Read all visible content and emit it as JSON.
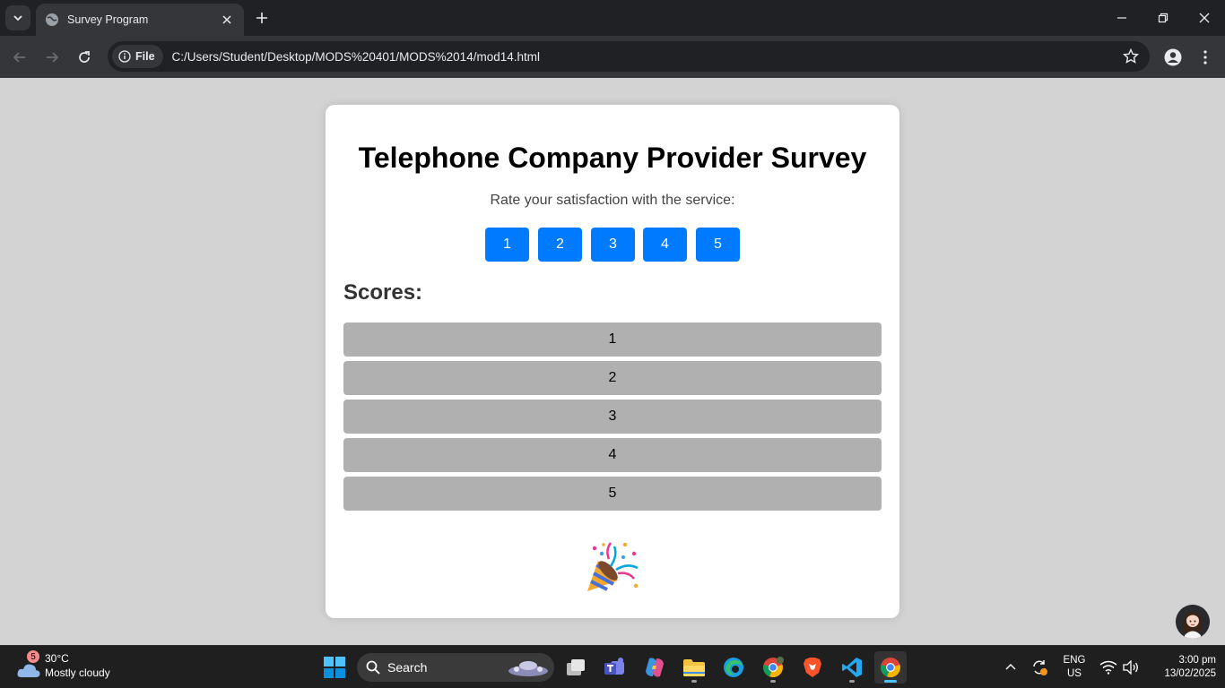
{
  "browser": {
    "tab_title": "Survey Program",
    "site_chip": "File",
    "url": "C:/Users/Student/Desktop/MODS%20401/MODS%2014/mod14.html"
  },
  "page": {
    "title": "Telephone Company Provider Survey",
    "prompt": "Rate your satisfaction with the service:",
    "rating_buttons": [
      "1",
      "2",
      "3",
      "4",
      "5"
    ],
    "scores_heading": "Scores:",
    "scores": [
      "1",
      "2",
      "3",
      "4",
      "5"
    ],
    "celebration_icon": "party-popper-icon"
  },
  "colors": {
    "accent": "#007bff",
    "score_row": "#b0b0b0",
    "page_bg": "#d3d3d3"
  },
  "taskbar": {
    "weather": {
      "badge": "5",
      "temp": "30°C",
      "desc": "Mostly cloudy"
    },
    "search_label": "Search",
    "language": {
      "line1": "ENG",
      "line2": "US"
    },
    "clock": {
      "time": "3:00 pm",
      "date": "13/02/2025"
    }
  }
}
